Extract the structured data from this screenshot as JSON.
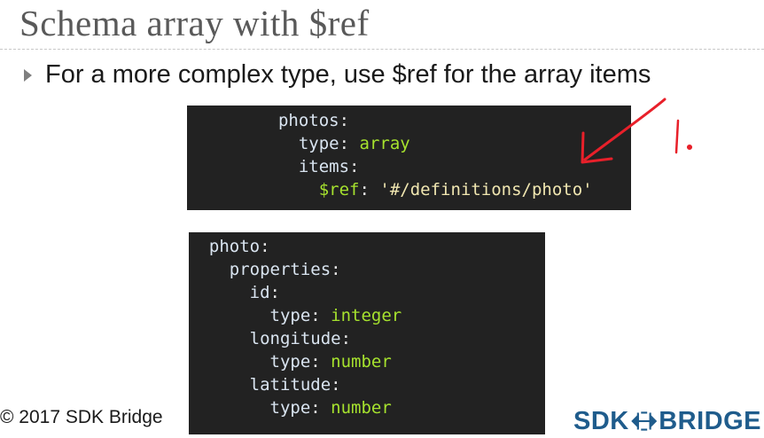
{
  "slide": {
    "title": "Schema array with $ref",
    "bullet": "For a more complex type, use $ref for the array items",
    "footer": "© 2017 SDK Bridge",
    "logo": {
      "left": "SDK",
      "right": "BRIDGE"
    },
    "annotation": {
      "text": "1.",
      "color": "#e8202a"
    }
  },
  "code_block_1": {
    "lines": [
      {
        "key": "photos",
        "value": ""
      },
      {
        "key": "type",
        "value": "array"
      },
      {
        "key": "items",
        "value": ""
      },
      {
        "key": "$ref",
        "value": "'#/definitions/photo'"
      }
    ]
  },
  "code_block_2": {
    "lines": [
      {
        "key": "photo",
        "value": ""
      },
      {
        "key": "properties",
        "value": ""
      },
      {
        "key": "id",
        "value": ""
      },
      {
        "key": "type",
        "value": "integer"
      },
      {
        "key": "longitude",
        "value": ""
      },
      {
        "key": "type",
        "value": "number"
      },
      {
        "key": "latitude",
        "value": ""
      },
      {
        "key": "type",
        "value": "number"
      }
    ]
  },
  "colors": {
    "code_background": "#222222",
    "code_value": "#a6e22e",
    "code_string": "#f0e6b0",
    "logo_blue": "#1f5c8c"
  }
}
